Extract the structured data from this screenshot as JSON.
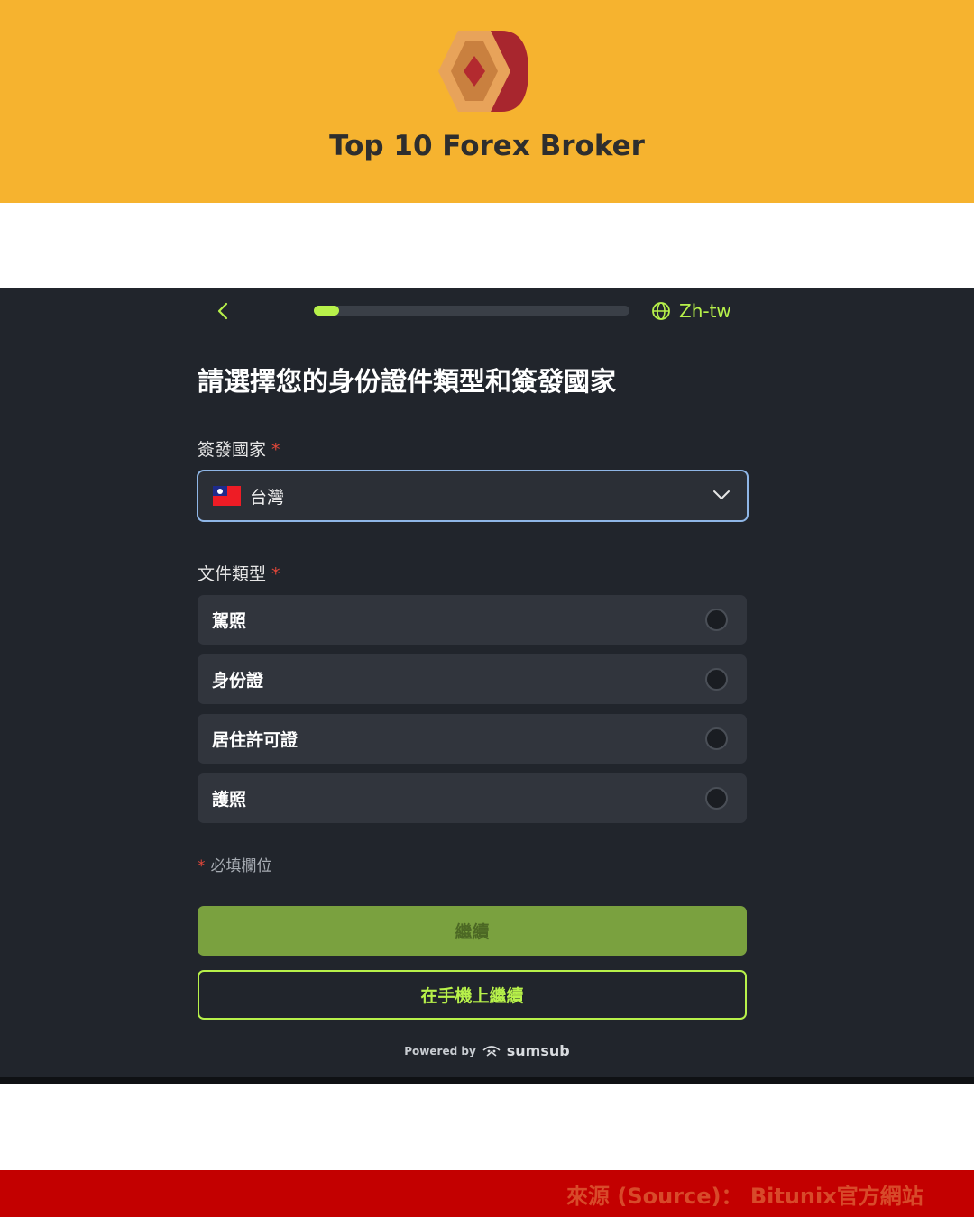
{
  "banner": {
    "title": "Top 10 Forex Broker",
    "bg_color": "#f6b32f"
  },
  "app": {
    "progress": 0.08,
    "language_label": "Zh-tw",
    "heading": "請選擇您的身份證件類型和簽發國家",
    "country_field": {
      "label": "簽發國家",
      "required_mark": "*",
      "selected_value": "台灣",
      "flag_icon": "taiwan-flag-icon"
    },
    "document_field": {
      "label": "文件類型",
      "required_mark": "*",
      "options": [
        {
          "label": "駕照",
          "selected": false
        },
        {
          "label": "身份證",
          "selected": false
        },
        {
          "label": "居住許可證",
          "selected": false
        },
        {
          "label": "護照",
          "selected": false
        }
      ]
    },
    "required_note": {
      "mark": "*",
      "text": "必填欄位"
    },
    "continue_label": "繼續",
    "continue_on_phone_label": "在手機上繼續",
    "powered_by": "Powered by",
    "powered_brand": "sumsub",
    "accent_color": "#b7f14a"
  },
  "footer": {
    "source_text": "來源 (Source)： Bitunix官方網站",
    "bg_color": "#c30000"
  }
}
